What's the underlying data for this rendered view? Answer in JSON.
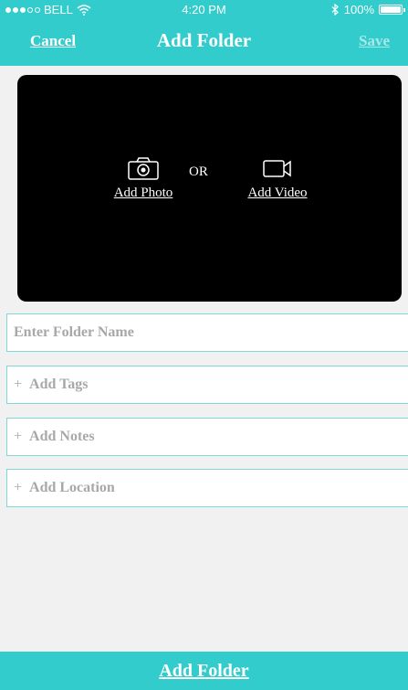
{
  "status_bar": {
    "carrier": "BELL",
    "time": "4:20 PM",
    "battery": "100%",
    "signal_dots_filled": 3,
    "signal_dots_total": 5
  },
  "nav": {
    "cancel_label": "Cancel",
    "title": "Add Folder",
    "save_label": "Save"
  },
  "media": {
    "photo_label": "Add Photo",
    "separator": "OR",
    "video_label": "Add Video",
    "photo_icon": "camera-icon",
    "video_icon": "video-camera-icon"
  },
  "form": {
    "name_placeholder": "Enter Folder Name",
    "tags_label": "Add Tags",
    "notes_label": "Add Notes",
    "location_label": "Add Location",
    "plus": "+"
  },
  "footer": {
    "add_folder_label": "Add Folder"
  },
  "colors": {
    "accent": "#33cccc",
    "field_border": "#7fd8d8",
    "background": "#f1f1f1"
  }
}
